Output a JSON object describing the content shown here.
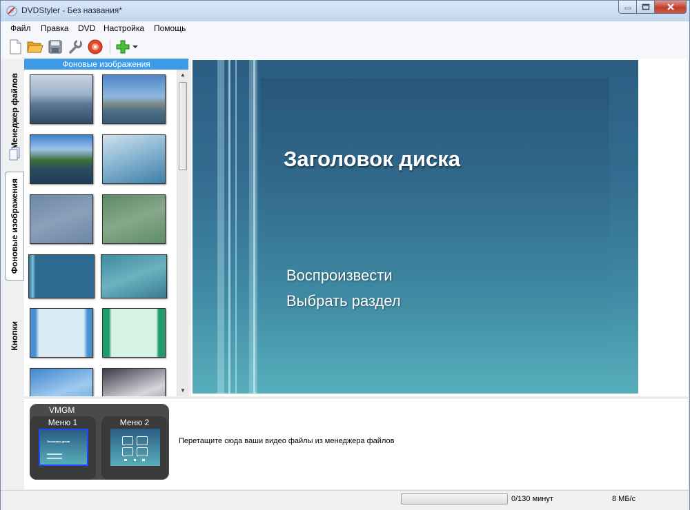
{
  "window": {
    "title": "DVDStyler - Без названия*"
  },
  "menubar": [
    "Файл",
    "Правка",
    "DVD",
    "Настройка",
    "Помощь"
  ],
  "toolbar": {
    "buttons": [
      "new-icon",
      "open-icon",
      "save-icon",
      "settings-icon",
      "burn-disc-icon",
      "add-icon"
    ]
  },
  "tabs": [
    {
      "label": "Менеджер файлов"
    },
    {
      "label": "Фоновые изображения"
    },
    {
      "label": "Кнопки"
    }
  ],
  "panel": {
    "header": "Фоновые изображения"
  },
  "preview": {
    "title": "Заголовок диска",
    "buttons": [
      "Воспроизвести",
      "Выбрать раздел"
    ]
  },
  "titleset": {
    "vmgm": "VMGM",
    "menus": [
      "Меню 1",
      "Меню 2"
    ],
    "mini_title": "Заголовок диска",
    "drop_hint": "Перетащите сюда ваши видео файлы из менеджера файлов"
  },
  "status": {
    "progress": 0,
    "duration": "0/130 минут",
    "rate": "8 МБ/с"
  }
}
